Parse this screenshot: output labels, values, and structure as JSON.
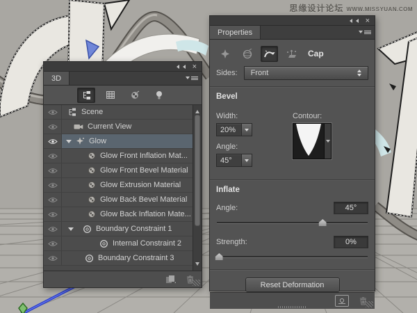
{
  "watermark": {
    "site_cn": "思缘设计论坛",
    "site_url": "WWW.MISSYUAN.COM"
  },
  "colors": {
    "panel_bg": "#535353",
    "selection_row": "#5a656f",
    "scene_bg": "#a9a7a2",
    "axis_blue": "#2b3fd0"
  },
  "icons": {
    "panel_collapse": "double-left-triangles",
    "panel_close": "×",
    "panel_menu": "triangle-with-lines",
    "filter_scene": "hierarchy-tree",
    "filter_meshes": "grid",
    "filter_materials": "checker-sphere",
    "filter_lights": "light-bulb",
    "visibility": "eye",
    "expander": "triangle-down",
    "prop_mesh": "star",
    "prop_deform": "wire-sphere",
    "prop_cap": "curve-swoosh",
    "prop_coordinates": "axes-box",
    "sides_stepper": "up-down-triangles",
    "new_item": "page",
    "delete": "trashcan",
    "move_to_ground": "boxed-sphere"
  },
  "panels": {
    "three_d": {
      "tab": "3D",
      "rows": [
        {
          "label": "Scene"
        },
        {
          "label": "Current View"
        },
        {
          "label": "Glow"
        },
        {
          "label": "Glow Front Inflation Mat..."
        },
        {
          "label": "Glow Front Bevel Material"
        },
        {
          "label": "Glow Extrusion Material"
        },
        {
          "label": "Glow Back Bevel Material"
        },
        {
          "label": "Glow Back Inflation Mate..."
        },
        {
          "label": "Boundary Constraint 1"
        },
        {
          "label": "Internal Constraint 2"
        },
        {
          "label": "Boundary Constraint 3"
        }
      ]
    },
    "properties": {
      "tab": "Properties",
      "mesh_label": "Cap",
      "sides": {
        "label": "Sides:",
        "value": "Front"
      },
      "bevel": {
        "heading": "Bevel",
        "width_label": "Width:",
        "width_value": "20%",
        "angle_label": "Angle:",
        "angle_value": "45°",
        "contour_label": "Contour:"
      },
      "inflate": {
        "heading": "Inflate",
        "angle_label": "Angle:",
        "angle_value": "45°",
        "angle_slider_percent": 70,
        "strength_label": "Strength:",
        "strength_value": "0%",
        "strength_slider_percent": 2
      },
      "reset_button": "Reset Deformation"
    }
  }
}
